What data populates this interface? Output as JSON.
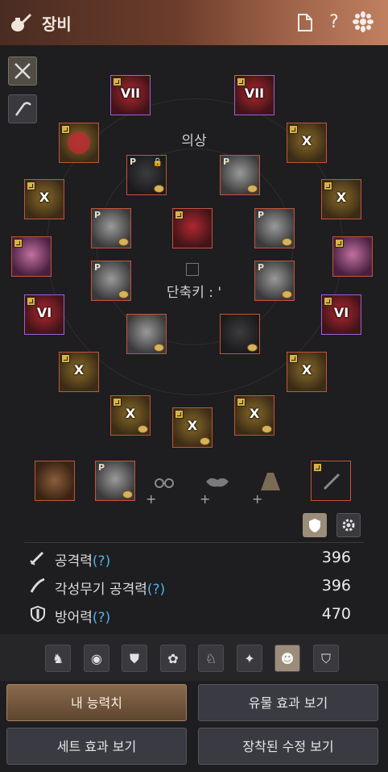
{
  "window": {
    "title": "장비"
  },
  "header": {
    "doc_icon": "document-icon",
    "help": "?",
    "settings_icon": "flower-gear-icon"
  },
  "side_buttons": [
    {
      "name": "sword-cross-icon"
    },
    {
      "name": "scythe-icon"
    }
  ],
  "equipment": {
    "costume_label": "의상",
    "shortcut_label": "단축키 : '",
    "enhancement": {
      "top_left": "VII",
      "top_right": "VII",
      "left_ring": "X",
      "right_ring": "X",
      "left_earring": "X",
      "right_earring": "X",
      "left_glove": "VI",
      "right_glove": "VI",
      "left_belt": "X",
      "right_belt": "X",
      "left_weapon": "X",
      "center_weapon": "X",
      "right_weapon": "X"
    }
  },
  "controls": {
    "shield_toggle": "shield-toggle-icon",
    "settings": "gear-icon"
  },
  "stats": [
    {
      "label": "공격력",
      "help": "(?)",
      "value": "396",
      "icon": "sword-icon"
    },
    {
      "label": "각성무기 공격력",
      "help": "(?)",
      "value": "396",
      "icon": "awakening-sword-icon"
    },
    {
      "label": "방어력",
      "help": "(?)",
      "value": "470",
      "icon": "shield-icon"
    }
  ],
  "modes": [
    "horse-icon",
    "mask-icon",
    "armor-icon",
    "paw-icon",
    "knight-icon",
    "dancer-icon",
    "profile-icon",
    "shield-icon"
  ],
  "buttons": {
    "my_stats": "내 능력치",
    "relic_effects": "유물 효과 보기",
    "set_effects": "세트 효과 보기",
    "equipped_crystals": "장착된 수정 보기"
  }
}
